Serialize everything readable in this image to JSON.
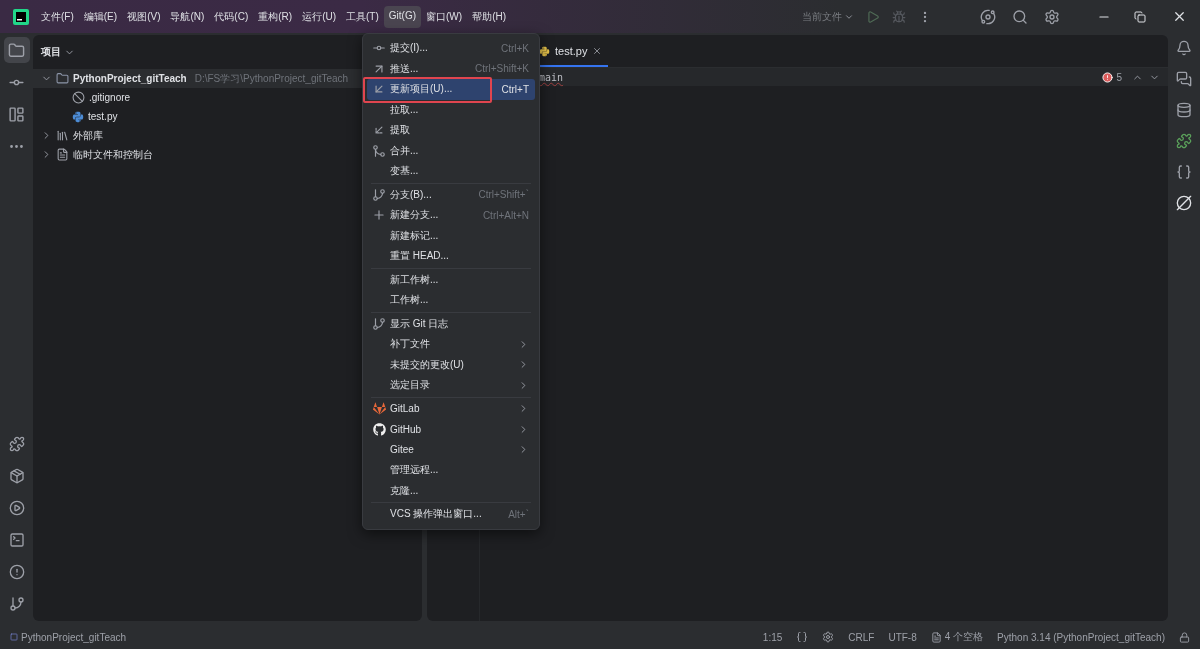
{
  "menubar": [
    {
      "label": "文件(F)",
      "selected": false
    },
    {
      "label": "编辑(E)",
      "selected": false
    },
    {
      "label": "视图(V)",
      "selected": false
    },
    {
      "label": "导航(N)",
      "selected": false
    },
    {
      "label": "代码(C)",
      "selected": false
    },
    {
      "label": "重构(R)",
      "selected": false
    },
    {
      "label": "运行(U)",
      "selected": false
    },
    {
      "label": "工具(T)",
      "selected": false
    },
    {
      "label": "Git(G)",
      "selected": true
    },
    {
      "label": "窗口(W)",
      "selected": false
    },
    {
      "label": "帮助(H)",
      "selected": false
    }
  ],
  "run_config": "当前文件",
  "left_tools": [
    {
      "selected": true
    },
    {
      "selected": false
    },
    {
      "selected": false
    },
    {
      "selected": false
    }
  ],
  "left_tools_bottom": [
    {
      "selected": false
    },
    {
      "selected": false
    },
    {
      "selected": false
    },
    {
      "selected": false
    },
    {
      "selected": false
    },
    {
      "selected": false
    }
  ],
  "project_panel": {
    "title": "项目",
    "tree": [
      {
        "label": "PythonProject_gitTeach",
        "path": "D:\\FS学习\\PythonProject_gitTeach",
        "expanded": true,
        "selected": true,
        "children": [
          {
            "label": ".gitignore"
          },
          {
            "label": "test.py"
          }
        ]
      },
      {
        "label": "外部库",
        "expanded": false,
        "selected": false
      },
      {
        "label": "临时文件和控制台",
        "expanded": false,
        "selected": false
      }
    ]
  },
  "editor": {
    "tab": "test.py",
    "breadcrumb": "main",
    "error_count": "5"
  },
  "git_menu": [
    [
      {
        "label": "提交(I)...",
        "shortcut": "Ctrl+K",
        "selected": false
      },
      {
        "label": "推送...",
        "shortcut": "Ctrl+Shift+K",
        "selected": false
      },
      {
        "label": "更新项目(U)...",
        "shortcut": "Ctrl+T",
        "selected": true,
        "outlined": true
      },
      {
        "label": "拉取...",
        "selected": false
      },
      {
        "label": "提取",
        "selected": false
      },
      {
        "label": "合并...",
        "selected": false
      },
      {
        "label": "变基...",
        "selected": false
      }
    ],
    [
      {
        "label": "分支(B)...",
        "shortcut": "Ctrl+Shift+`",
        "selected": false
      },
      {
        "label": "新建分支...",
        "shortcut": "Ctrl+Alt+N",
        "selected": false
      },
      {
        "label": "新建标记...",
        "selected": false
      },
      {
        "label": "重置 HEAD...",
        "selected": false
      }
    ],
    [
      {
        "label": "新工作树...",
        "selected": false
      },
      {
        "label": "工作树...",
        "selected": false
      }
    ],
    [
      {
        "label": "显示 Git 日志",
        "selected": false
      },
      {
        "label": "补丁文件",
        "submenu": true,
        "selected": false
      },
      {
        "label": "未提交的更改(U)",
        "submenu": true,
        "selected": false
      },
      {
        "label": "选定目录",
        "submenu": true,
        "selected": false
      }
    ],
    [
      {
        "label": "GitLab",
        "submenu": true,
        "selected": false
      },
      {
        "label": "GitHub",
        "submenu": true,
        "selected": false
      },
      {
        "label": "Gitee",
        "submenu": true,
        "selected": false
      },
      {
        "label": "管理远程...",
        "selected": false
      },
      {
        "label": "克隆...",
        "selected": false
      }
    ],
    [
      {
        "label": "VCS 操作弹出窗口...",
        "shortcut": "Alt+`",
        "selected": false
      }
    ]
  ],
  "status_bar": {
    "project": "PythonProject_gitTeach",
    "position": "1:15",
    "line_ending": "CRLF",
    "encoding": "UTF-8",
    "indent": "4 个空格",
    "interpreter": "Python 3.14 (PythonProject_gitTeach)"
  }
}
